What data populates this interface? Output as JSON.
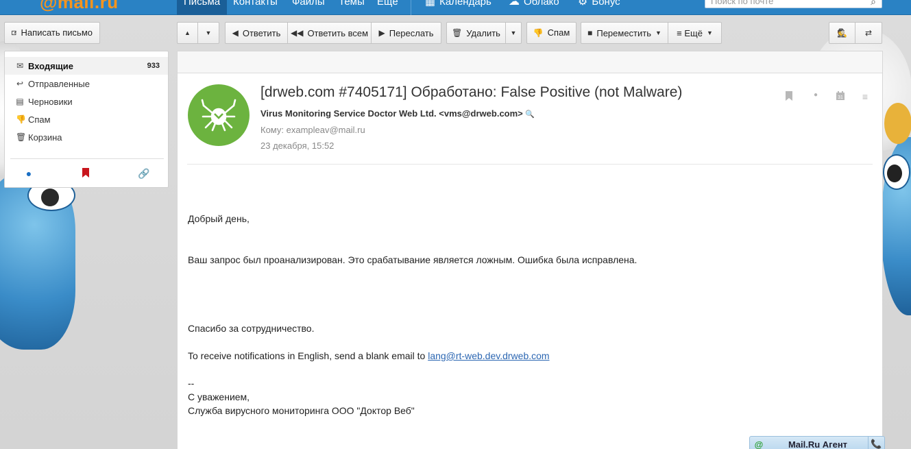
{
  "header": {
    "logo": "@mail.ru",
    "nav": [
      {
        "label": "Письма",
        "active": true
      },
      {
        "label": "Контакты",
        "active": false
      },
      {
        "label": "Файлы",
        "active": false
      },
      {
        "label": "Темы",
        "active": false
      },
      {
        "label": "Ещё",
        "active": false
      }
    ],
    "services": [
      {
        "label": "Календарь",
        "icon": "calendar-icon"
      },
      {
        "label": "Облако",
        "icon": "cloud-icon"
      },
      {
        "label": "Бонус",
        "icon": "gear-icon"
      }
    ],
    "search_placeholder": "Поиск по почте"
  },
  "toolbar": {
    "compose": "Написать письмо",
    "reply": "Ответить",
    "reply_all": "Ответить всем",
    "forward": "Переслать",
    "delete": "Удалить",
    "spam": "Спам",
    "move": "Переместить",
    "more": "≡ Ещё"
  },
  "folders": [
    {
      "label": "Входящие",
      "count": "933",
      "icon": "inbox-icon",
      "active": true
    },
    {
      "label": "Отправленные",
      "icon": "sent-icon"
    },
    {
      "label": "Черновики",
      "icon": "drafts-icon"
    },
    {
      "label": "Спам",
      "icon": "spam-icon"
    },
    {
      "label": "Корзина",
      "icon": "trash-icon"
    }
  ],
  "message": {
    "subject": "[drweb.com #7405171] Обработано: False Positive (not Malware)",
    "sender": "Virus Monitoring Service Doctor Web Ltd. <vms@drweb.com>",
    "recipient": "Кому: exampleav@mail.ru",
    "date": "23 декабря, 15:52",
    "body": {
      "greeting": "Добрый день,",
      "line1": "Ваш запрос был проанализирован. Это срабатывание является ложным. Ошибка была исправлена.",
      "thanks": "Спасибо за сотрудничество.",
      "english_prefix": "To receive notifications in English, send a blank email to ",
      "english_link": "lang@rt-web.dev.drweb.com",
      "dashes": "--",
      "regards": "С уважением,",
      "signature": "Служба вирусного мониторинга ООО \"Доктор Веб\""
    }
  },
  "agent": {
    "title": "Mail.Ru Агент"
  },
  "colors": {
    "topbar": "#2a82c4",
    "avatar": "#6cb33f",
    "logo": "#f7941d",
    "link": "#2b66b2"
  }
}
